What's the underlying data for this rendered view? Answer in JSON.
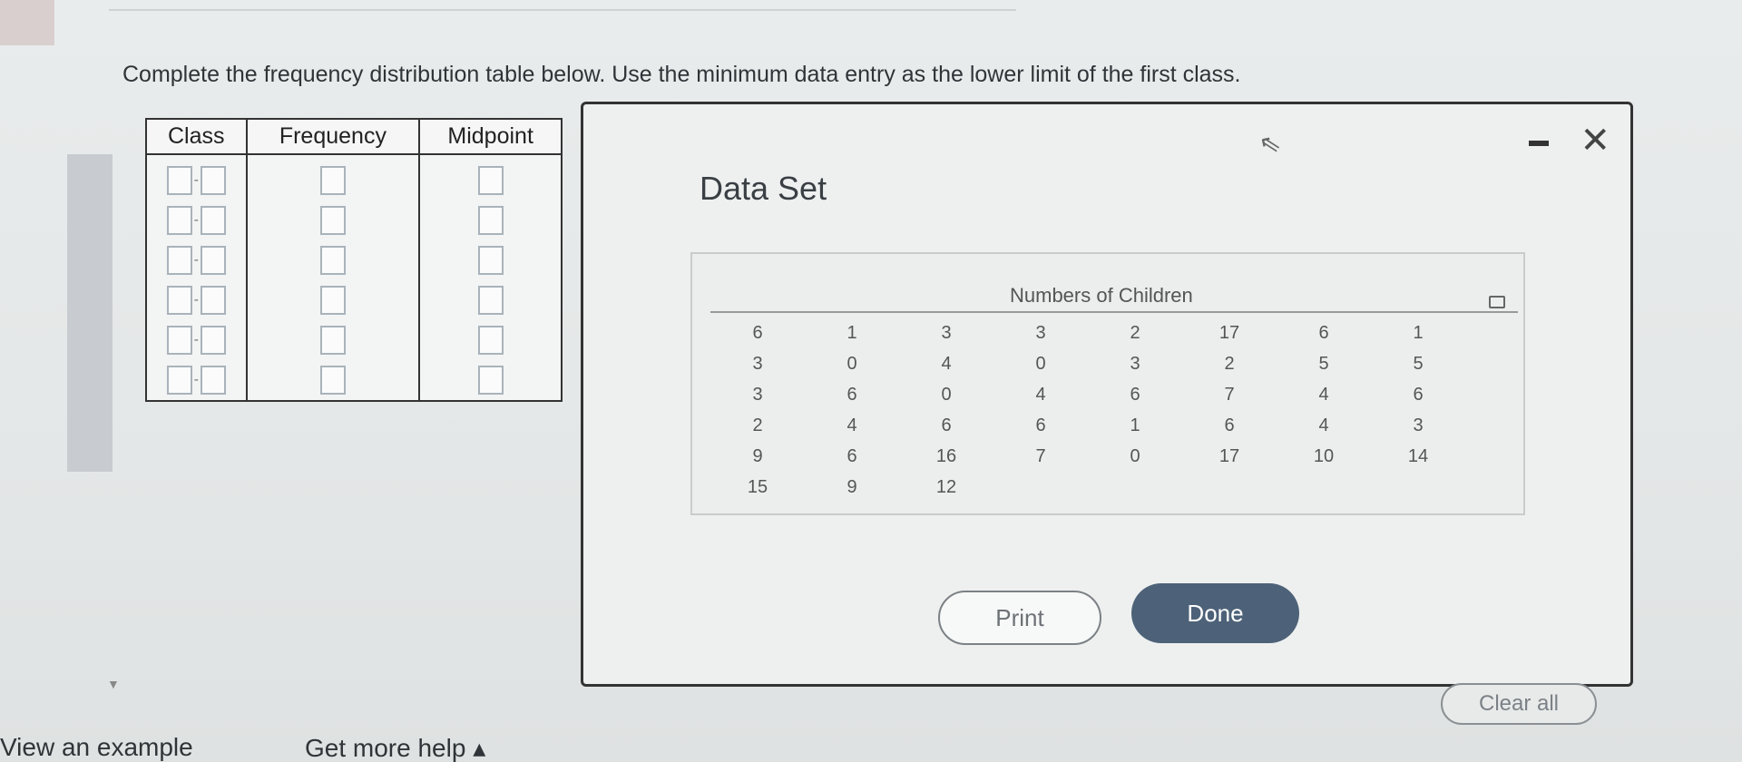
{
  "instruction": "Complete the frequency distribution table below. Use the minimum data entry as the lower limit of the first class.",
  "table": {
    "headers": [
      "Class",
      "Frequency",
      "Midpoint"
    ],
    "class_separator": "-",
    "rows": 6
  },
  "dialog": {
    "title": "Data Set",
    "data_caption": "Numbers of Children",
    "data_rows": [
      [
        "6",
        "1",
        "3",
        "3",
        "2",
        "17",
        "6",
        "1"
      ],
      [
        "3",
        "0",
        "4",
        "0",
        "3",
        "2",
        "5",
        "5"
      ],
      [
        "3",
        "6",
        "0",
        "4",
        "6",
        "7",
        "4",
        "6"
      ],
      [
        "2",
        "4",
        "6",
        "6",
        "1",
        "6",
        "4",
        "3"
      ],
      [
        "9",
        "6",
        "16",
        "7",
        "0",
        "17",
        "10",
        "14"
      ],
      [
        "15",
        "9",
        "12",
        "",
        "",
        "",
        "",
        ""
      ]
    ],
    "print_label": "Print",
    "done_label": "Done",
    "close_glyph": "✕",
    "minimize_icon": "minimize-icon",
    "copy_icon": "copy-icon"
  },
  "footer": {
    "example_label": "View an example",
    "help_label": "Get more help ▴",
    "clear_label": "Clear all"
  },
  "colors": {
    "done_button": "#4d6278",
    "background": "#e6e9e9",
    "input_border": "#a9b3bb"
  }
}
